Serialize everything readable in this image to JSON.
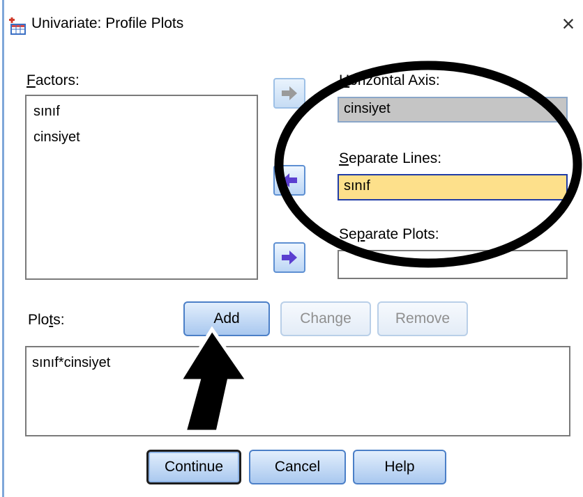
{
  "window": {
    "title": "Univariate: Profile Plots",
    "close_glyph": "×",
    "icon": "spss-app-icon"
  },
  "factors": {
    "label": "Factors:",
    "items": [
      "sınıf",
      "cinsiyet"
    ]
  },
  "horizontal_axis": {
    "label": "Horizontal Axis:",
    "value": "cinsiyet"
  },
  "separate_lines": {
    "label": "Separate Lines:",
    "value": "sınıf"
  },
  "separate_plots": {
    "label": "Separate Plots:",
    "value": ""
  },
  "move_buttons": {
    "to_horizontal": "arrow-right-icon",
    "from_separate_lines": "arrow-left-icon",
    "to_separate_plots": "arrow-right-icon"
  },
  "plots": {
    "label": "Plots:",
    "add_label": "Add",
    "change_label": "Change",
    "remove_label": "Remove",
    "items": [
      "sınıf*cinsiyet"
    ]
  },
  "footer": {
    "continue_label": "Continue",
    "cancel_label": "Cancel",
    "help_label": "Help"
  },
  "colors": {
    "selected_field": "#c5c5c5",
    "focused_field": "#fde08b",
    "arrow_icon": "#5b3fd0",
    "annotation": "#000000"
  }
}
